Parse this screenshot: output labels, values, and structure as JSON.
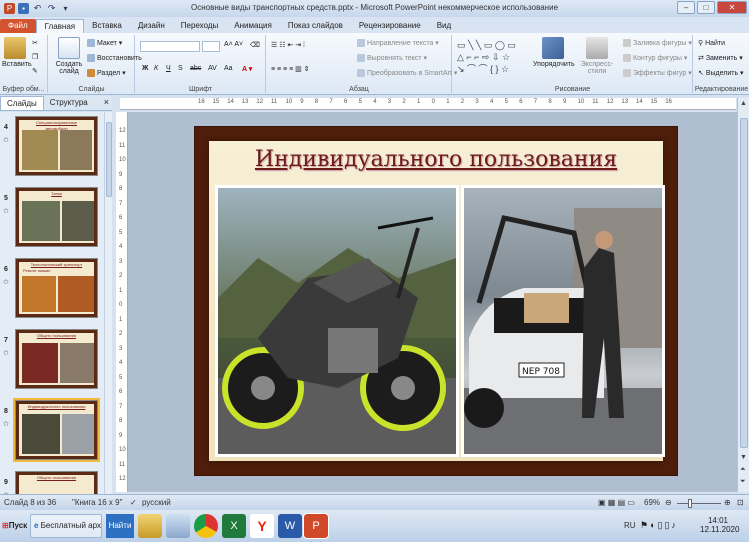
{
  "window": {
    "title": "Основные виды транспортных средств.pptx - Microsoft PowerPoint некоммерческое использование"
  },
  "tabs": [
    "Файл",
    "Главная",
    "Вставка",
    "Дизайн",
    "Переходы",
    "Анимация",
    "Показ слайдов",
    "Рецензирование",
    "Вид"
  ],
  "ribbon": {
    "clipboard": {
      "paste": "Вставить",
      "label": "Буфер обм..."
    },
    "slides": {
      "new_slide": "Создать слайд",
      "layout": "Макет",
      "reset": "Восстановить",
      "section": "Раздел",
      "label": "Слайды"
    },
    "font": {
      "bold": "Ж",
      "italic": "К",
      "underline": "Ч",
      "strike": "S",
      "abc": "abc",
      "spacing": "AV",
      "case": "Aa",
      "label": "Шрифт"
    },
    "paragraph": {
      "text_direction": "Направление текста",
      "align_text": "Выровнять текст",
      "smartart": "Преобразовать в SmartArt",
      "label": "Абзац"
    },
    "drawing": {
      "arrange": "Упорядочить",
      "quick_styles": "Экспресс-стили",
      "fill": "Заливка фигуры",
      "outline": "Контур фигуры",
      "effects": "Эффекты фигур",
      "label": "Рисование"
    },
    "editing": {
      "find": "Найти",
      "replace": "Заменить",
      "select": "Выделить",
      "label": "Редактирование"
    }
  },
  "pane": {
    "tab_slides": "Слайды",
    "tab_outline": "Структура",
    "close": "×"
  },
  "thumbnails": [
    {
      "num": "4",
      "title": "Специализированные",
      "sub": "автомобили"
    },
    {
      "num": "5",
      "title": "Танки",
      "sub": ""
    },
    {
      "num": "6",
      "title": "Технологический транспорт",
      "sub": "Ремонт машин"
    },
    {
      "num": "7",
      "title": "Общего пользования",
      "sub": ""
    },
    {
      "num": "8",
      "title": "Индивидуального пользования",
      "sub": ""
    },
    {
      "num": "9",
      "title": "Общего пользования",
      "sub": ""
    }
  ],
  "hruler": [
    "16",
    "15",
    "14",
    "13",
    "12",
    "11",
    "10",
    "9",
    "8",
    "7",
    "6",
    "5",
    "4",
    "3",
    "2",
    "1",
    "0",
    "1",
    "2",
    "3",
    "4",
    "5",
    "6",
    "7",
    "8",
    "9",
    "10",
    "11",
    "12",
    "13",
    "14",
    "15",
    "16"
  ],
  "vruler": [
    "12",
    "11",
    "10",
    "9",
    "8",
    "7",
    "6",
    "5",
    "4",
    "3",
    "2",
    "1",
    "0",
    "1",
    "2",
    "3",
    "4",
    "5",
    "6",
    "7",
    "8",
    "9",
    "10",
    "11",
    "12"
  ],
  "slide": {
    "title": "Индивидуального пользования",
    "plate": "NEP 708"
  },
  "status": {
    "slide_of": "Слайд 8 из 36",
    "theme": "\"Книга 16 х 9\"",
    "lang": "русский",
    "zoom": "69%"
  },
  "taskbar": {
    "start": "Пуск",
    "browser": "Бесплатный арх...",
    "find": "Найти",
    "lang": "RU",
    "time": "14:01",
    "date": "12.11.2020"
  }
}
